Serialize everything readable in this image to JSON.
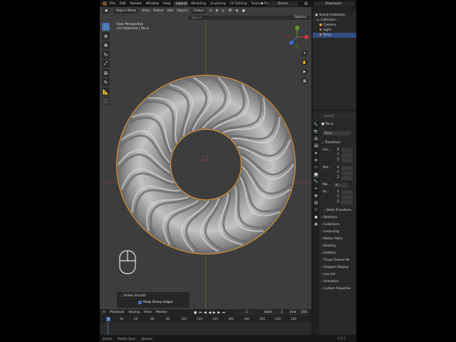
{
  "topbar": {
    "menu": [
      "File",
      "Edit",
      "Render",
      "Window",
      "Help"
    ],
    "workspaces": [
      "Layout",
      "Modeling",
      "Sculpting",
      "UV Editing",
      "Texture Paint"
    ],
    "active_workspace": "Layout",
    "scene": "Scene",
    "view_layer": "ViewLayer"
  },
  "viewport": {
    "mode": "Object Mode",
    "menus": [
      "View",
      "Select",
      "Add",
      "Object"
    ],
    "orientation": "Global",
    "search_placeholder": "Search",
    "overlay_line1": "User Perspective",
    "overlay_line2": "(1) Collection | Torus",
    "options_label": "Options",
    "tools": [
      "select-box",
      "cursor",
      "move",
      "rotate",
      "scale",
      "transform",
      "annotate",
      "measure",
      "add-cube"
    ]
  },
  "redo_panel": {
    "title": "Shade Smooth",
    "option": "Keep Sharp Edges",
    "checked": true
  },
  "timeline": {
    "menus": [
      "Playback",
      "Keying",
      "View",
      "Marker"
    ],
    "current_frame": "1",
    "start_label": "Start",
    "start_value": "1",
    "end_label": "End",
    "end_value": "250",
    "ticks": [
      "1",
      "20",
      "40",
      "60",
      "80",
      "100",
      "120",
      "140",
      "160",
      "180",
      "200",
      "220",
      "240"
    ],
    "playhead": "1"
  },
  "statusbar": {
    "items": [
      "Select",
      "Rotate View",
      "Options"
    ],
    "version": "4.5.3"
  },
  "outliner": {
    "title": "Scene Collection",
    "items": [
      {
        "label": "Collection",
        "selected": false
      },
      {
        "label": "Camera",
        "selected": false
      },
      {
        "label": "Light",
        "selected": false
      },
      {
        "label": "Torus",
        "selected": true
      }
    ]
  },
  "properties": {
    "search_placeholder": "Search",
    "object_name": "Torus",
    "object_datablock": "Torus",
    "transform_label": "Transform",
    "location_label": "Loc...",
    "rotation_label": "Rot...",
    "mode_label": "Mo...",
    "mode_value": "X...",
    "scale_label": "Sc...",
    "axis_x": "X",
    "axis_y": "Y",
    "axis_z": "Z",
    "delta_label": "Delta Transform",
    "sections": [
      "Relations",
      "Collections",
      "Instancing",
      "Motion Paths",
      "Shading",
      "Visibility",
      "Tissue Texture Re",
      "Viewport Display",
      "Line Art",
      "Animation",
      "Custom Properties"
    ]
  },
  "colors": {
    "accent": "#4772b3",
    "selection_outline": "#e89a2c",
    "mesh": "#b8b8b8"
  }
}
